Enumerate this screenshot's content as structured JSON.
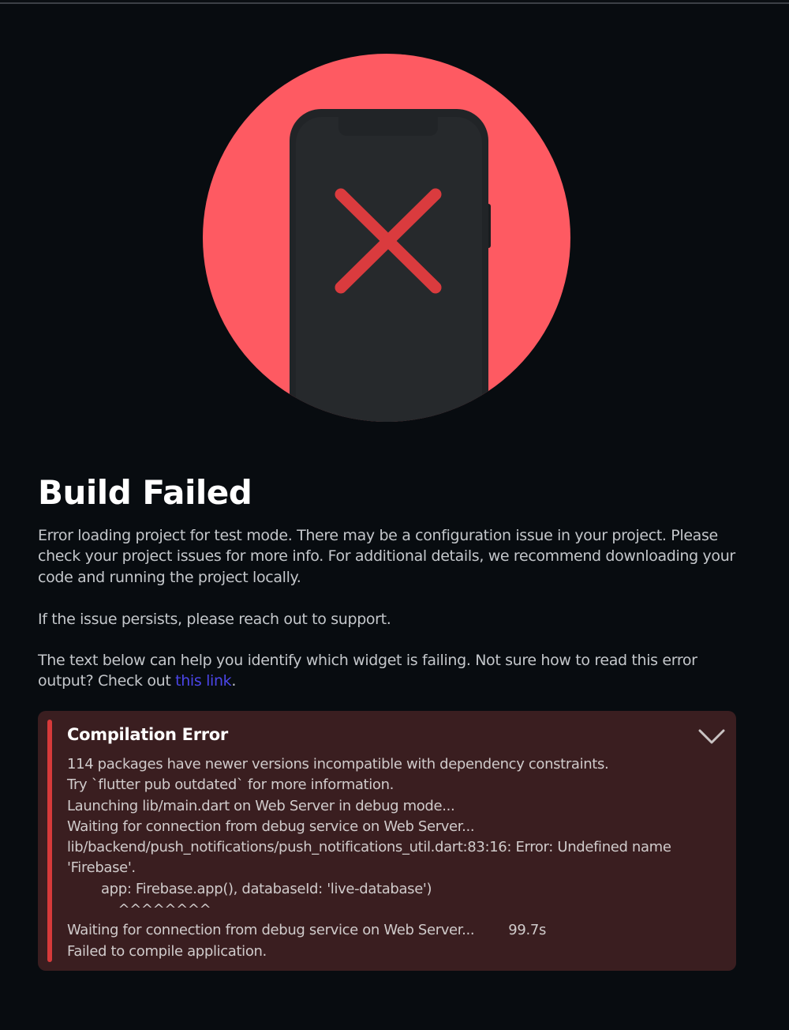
{
  "page": {
    "title": "Build Failed",
    "paragraph1": "Error loading project for test mode. There may be a configuration issue in your project. Please check your project issues for more info. For additional details, we recommend downloading your code and running the project locally.",
    "paragraph2": "If the issue persists, please reach out to support.",
    "paragraph3_prefix": "The text below can help you identify which widget is failing. Not sure how to read this error output? Check out ",
    "link_text": "this link",
    "paragraph3_suffix": "."
  },
  "illustration": {
    "icon": "phone-error-icon",
    "circle_color": "#fe5a62",
    "phone_color": "#212427",
    "cross_color": "#da3b3e"
  },
  "error_panel": {
    "title": "Compilation Error",
    "toggle_icon": "chevron-down-icon",
    "log": "114 packages have newer versions incompatible with dependency constraints.\nTry `flutter pub outdated` for more information.\nLaunching lib/main.dart on Web Server in debug mode...\nWaiting for connection from debug service on Web Server...\nlib/backend/push_notifications/push_notifications_util.dart:83:16: Error: Undefined name 'Firebase'.\n        app: Firebase.app(), databaseId: 'live-database')\n            ^^^^^^^^\nWaiting for connection from debug service on Web Server...        99.7s\nFailed to compile application.",
    "background_color": "#3a1e20",
    "accent_color": "#d63a3a"
  }
}
